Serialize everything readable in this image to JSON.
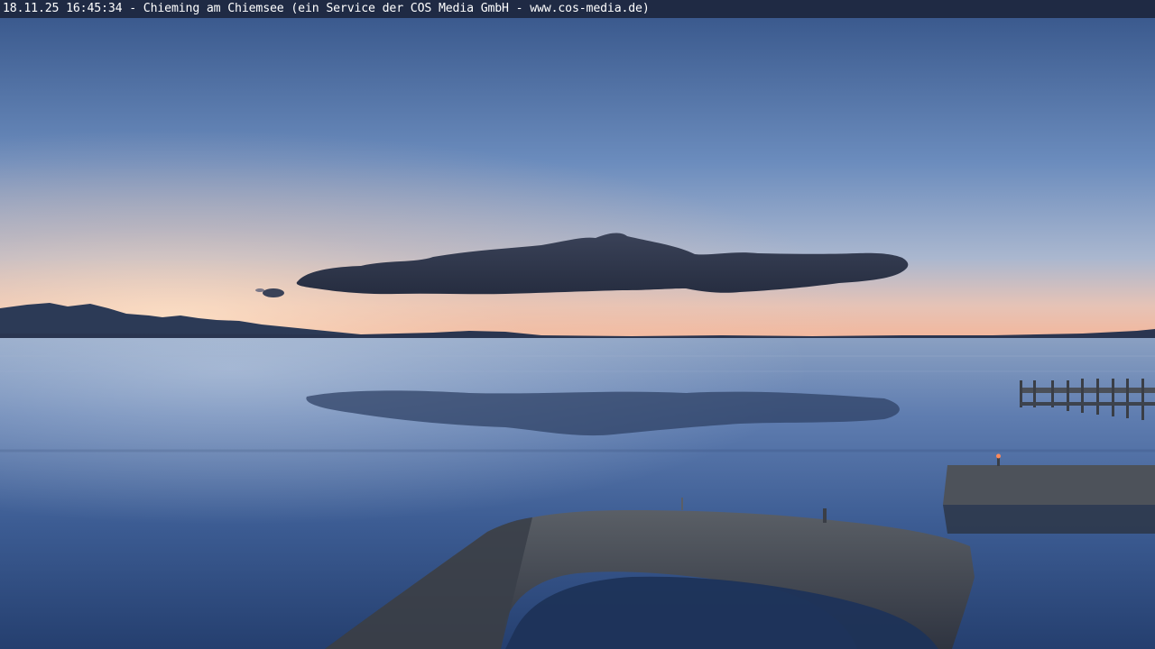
{
  "caption": {
    "text": "18.11.25 16:45:34 - Chieming am Chiemsee (ein Service der COS Media GmbH - www.cos-media.de)"
  },
  "scene": {
    "colors": {
      "sky_top": "#3f5f93",
      "sky_mid": "#6f8fbf",
      "sky_horizon_glow": "#f2b89a",
      "cloud": "#2b3348",
      "mountains": "#2e3b55",
      "water_top": "#7f97bb",
      "water_bottom": "#223a66",
      "pier": "#4a4f58",
      "breakwater": "#3d4451"
    },
    "icons": [
      "light-icon"
    ]
  }
}
